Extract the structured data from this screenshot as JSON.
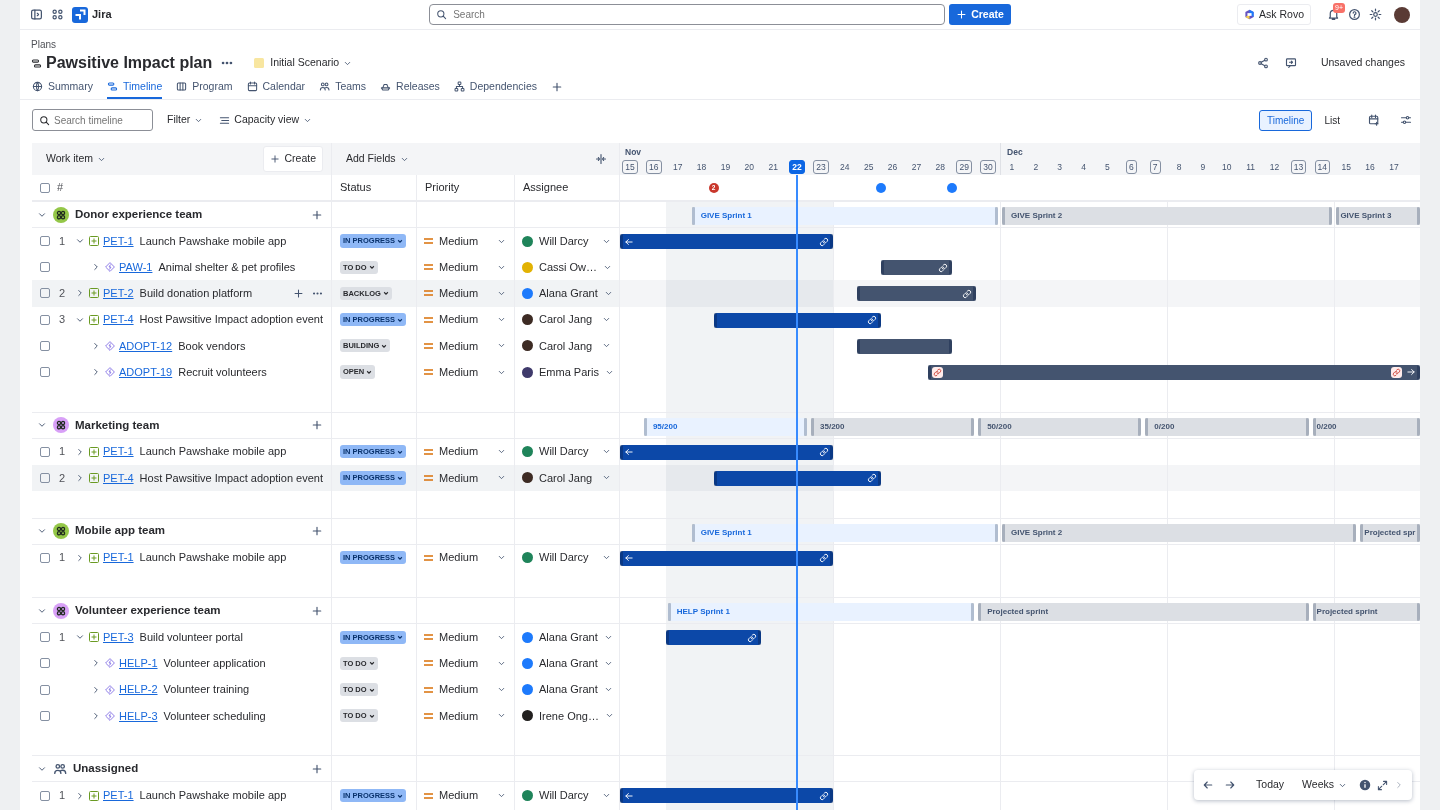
{
  "topbar": {
    "product": "Jira",
    "search": {
      "placeholder": "Search"
    },
    "create": "Create",
    "ask": "Ask Rovo",
    "notifications": "9+"
  },
  "breadcrumb": "Plans",
  "plan": {
    "title": "Pawsitive Impact plan",
    "scenario": "Initial Scenario",
    "unsaved": "Unsaved changes"
  },
  "tabs": [
    {
      "label": "Summary",
      "selected": false
    },
    {
      "label": "Timeline",
      "selected": true
    },
    {
      "label": "Program",
      "selected": false
    },
    {
      "label": "Calendar",
      "selected": false
    },
    {
      "label": "Teams",
      "selected": false
    },
    {
      "label": "Releases",
      "selected": false
    },
    {
      "label": "Dependencies",
      "selected": false
    }
  ],
  "toolbar": {
    "search": {
      "placeholder": "Search timeline"
    },
    "filter": "Filter",
    "capacity": "Capacity view",
    "views": [
      {
        "label": "Timeline",
        "selected": true
      },
      {
        "label": "List",
        "selected": false
      }
    ]
  },
  "table": {
    "work_item": "Work item",
    "create": "Create",
    "add_fields": "Add Fields",
    "select_all_checked": false,
    "columns": [
      "#",
      "Status",
      "Priority",
      "Assignee"
    ]
  },
  "timeline": {
    "days": [
      {
        "label": "15",
        "month": "Nov",
        "weekend": true,
        "today": false
      },
      {
        "label": "16",
        "weekend": true,
        "today": false
      },
      {
        "label": "17",
        "weekend": false,
        "today": false
      },
      {
        "label": "18",
        "weekend": false,
        "today": false
      },
      {
        "label": "19",
        "weekend": false,
        "today": false
      },
      {
        "label": "20",
        "weekend": false,
        "today": false
      },
      {
        "label": "21",
        "weekend": false,
        "today": false
      },
      {
        "label": "22",
        "weekend": true,
        "today": true
      },
      {
        "label": "23",
        "weekend": true,
        "today": false
      },
      {
        "label": "24",
        "weekend": false,
        "today": false
      },
      {
        "label": "25",
        "weekend": false,
        "today": false
      },
      {
        "label": "26",
        "weekend": false,
        "today": false
      },
      {
        "label": "27",
        "weekend": false,
        "today": false
      },
      {
        "label": "28",
        "weekend": false,
        "today": false
      },
      {
        "label": "29",
        "weekend": true,
        "today": false
      },
      {
        "label": "30",
        "weekend": true,
        "today": false
      },
      {
        "label": "1",
        "month": "Dec",
        "weekend": false,
        "today": false
      },
      {
        "label": "2",
        "weekend": false,
        "today": false
      },
      {
        "label": "3",
        "weekend": false,
        "today": false
      },
      {
        "label": "4",
        "weekend": false,
        "today": false
      },
      {
        "label": "5",
        "weekend": false,
        "today": false
      },
      {
        "label": "6",
        "weekend": true,
        "today": false
      },
      {
        "label": "7",
        "weekend": true,
        "today": false
      },
      {
        "label": "8",
        "weekend": false,
        "today": false
      },
      {
        "label": "9",
        "weekend": false,
        "today": false
      },
      {
        "label": "10",
        "weekend": false,
        "today": false
      },
      {
        "label": "11",
        "weekend": false,
        "today": false
      },
      {
        "label": "12",
        "weekend": false,
        "today": false
      },
      {
        "label": "13",
        "weekend": true,
        "today": false
      },
      {
        "label": "14",
        "weekend": true,
        "today": false
      },
      {
        "label": "15",
        "weekend": false,
        "today": false
      },
      {
        "label": "16",
        "weekend": false,
        "today": false
      },
      {
        "label": "17",
        "weekend": false,
        "today": false
      }
    ],
    "markers": [
      {
        "position": {
          "level": 0.1169
        },
        "kind": "warning",
        "label": "2"
      },
      {
        "position": {
          "level": 0.3258
        },
        "kind": "milestone"
      },
      {
        "position": {
          "level": 0.4154
        },
        "kind": "milestone"
      }
    ]
  },
  "teams": [
    {
      "name": "Donor experience team",
      "color": "#94c748",
      "expanded": true,
      "sprints": [
        {
          "label": "GIVE Sprint 1",
          "start": {
            "level": 0.0871
          },
          "end": {
            "level": 0.4751
          },
          "kind": "active"
        },
        {
          "label": "GIVE Sprint 2",
          "start": {
            "level": 0.4751
          },
          "end": {
            "level": 0.893
          },
          "kind": "future"
        },
        {
          "label": "GIVE Sprint 3",
          "start": {
            "level": 0.893
          },
          "end": {
            "level": 1
          },
          "kind": "future"
        }
      ],
      "rows": [
        {
          "rank": "1",
          "checked": false,
          "kind": "epic",
          "key": "PET-1",
          "summary": "Launch Pawshake mobile app",
          "expanded": true,
          "highlighted": false,
          "status": {
            "label": "IN PROGRESS",
            "kind": "progress"
          },
          "priority": "Medium",
          "assignee": {
            "name": "Will Darcy",
            "color": "#1f845a"
          },
          "bar": {
            "start": {
              "level": 0
            },
            "end": {
              "level": 0.2661
            },
            "end_link": {
              "kind": "ok"
            }
          },
          "children": [
            {
              "checked": false,
              "kind": "child",
              "key": "PAW-1",
              "summary": "Animal shelter & pet profiles",
              "expanded": false,
              "highlighted": false,
              "status": {
                "label": "TO DO",
                "kind": "default"
              },
              "priority": "Medium",
              "assignee": {
                "name": "Cassi Ow…",
                "color": "#e2b203"
              },
              "bar": {
                "start": {
                  "level": 0.3258
                },
                "end": {
                  "level": 0.4154
                },
                "end_link": {
                  "kind": "ok"
                }
              }
            }
          ]
        },
        {
          "rank": "2",
          "checked": false,
          "kind": "epic",
          "key": "PET-2",
          "summary": "Build donation platform",
          "expanded": false,
          "highlighted": true,
          "actions": true,
          "status": {
            "label": "BACKLOG",
            "kind": "default"
          },
          "priority": "Medium",
          "assignee": {
            "name": "Alana Grant",
            "color": "#1d7afc"
          },
          "bar": {
            "start": {
              "level": 0.296
            },
            "end": {
              "level": 0.4452
            },
            "end_link": {
              "kind": "ok"
            }
          }
        },
        {
          "rank": "3",
          "checked": false,
          "kind": "epic",
          "key": "PET-4",
          "summary": "Host Pawsitive Impact adoption event",
          "expanded": true,
          "highlighted": false,
          "status": {
            "label": "IN PROGRESS",
            "kind": "progress"
          },
          "priority": "Medium",
          "assignee": {
            "name": "Carol Jang",
            "color": "#3d2b24"
          },
          "bar": {
            "start": {
              "level": 0.1169
            },
            "end": {
              "level": 0.3258
            },
            "end_link": {
              "kind": "ok"
            }
          },
          "children": [
            {
              "checked": false,
              "kind": "child",
              "key": "ADOPT-12",
              "summary": "Book vendors",
              "expanded": false,
              "highlighted": false,
              "status": {
                "label": "BUILDING",
                "kind": "default"
              },
              "priority": "Medium",
              "assignee": {
                "name": "Carol Jang",
                "color": "#3d2b24"
              },
              "bar": {
                "start": {
                  "level": 0.296
                },
                "end": {
                  "level": 0.4154
                }
              }
            },
            {
              "checked": false,
              "kind": "child",
              "key": "ADOPT-19",
              "summary": "Recruit volunteers",
              "expanded": false,
              "highlighted": false,
              "status": {
                "label": "OPEN",
                "kind": "default"
              },
              "priority": "Medium",
              "assignee": {
                "name": "Emma Paris",
                "color": "#3f3a6b"
              },
              "bar": {
                "start": {
                  "level": 0.3855
                },
                "end": {
                  "level": 1
                },
                "start_link": {
                  "kind": "warning"
                },
                "end_link": {
                  "kind": "warning"
                }
              }
            }
          ]
        }
      ]
    },
    {
      "name": "Marketing team",
      "color": "#d8a0f7",
      "expanded": true,
      "sprints": [
        {
          "label": "95/200",
          "start": {
            "level": 0.0274
          },
          "end": {
            "level": 0.2363
          },
          "kind": "active"
        },
        {
          "label": "35/200",
          "start": {
            "level": 0.2363
          },
          "end": {
            "level": 0.4452
          },
          "kind": "future"
        },
        {
          "label": "50/200",
          "start": {
            "level": 0.4452
          },
          "end": {
            "level": 0.6542
          },
          "kind": "future"
        },
        {
          "label": "0/200",
          "start": {
            "level": 0.6542
          },
          "end": {
            "level": 0.8632
          },
          "kind": "future"
        },
        {
          "label": "0/200",
          "start": {
            "level": 0.8632
          },
          "end": {
            "level": 1
          },
          "kind": "future"
        }
      ],
      "rows": [
        {
          "rank": "1",
          "checked": false,
          "kind": "epic",
          "key": "PET-1",
          "summary": "Launch Pawshake mobile app",
          "expanded": false,
          "highlighted": false,
          "status": {
            "label": "IN PROGRESS",
            "kind": "progress"
          },
          "priority": "Medium",
          "assignee": {
            "name": "Will Darcy",
            "color": "#1f845a"
          },
          "bar": {
            "start": {
              "level": 0
            },
            "end": {
              "level": 0.2661
            },
            "end_link": {
              "kind": "ok"
            }
          }
        },
        {
          "rank": "2",
          "checked": false,
          "kind": "epic",
          "key": "PET-4",
          "summary": "Host Pawsitive Impact adoption event",
          "expanded": false,
          "highlighted": true,
          "status": {
            "label": "IN PROGRESS",
            "kind": "progress"
          },
          "priority": "Medium",
          "assignee": {
            "name": "Carol Jang",
            "color": "#3d2b24"
          },
          "bar": {
            "start": {
              "level": 0.1169
            },
            "end": {
              "level": 0.3258
            },
            "end_link": {
              "kind": "ok"
            }
          }
        }
      ]
    },
    {
      "name": "Mobile app team",
      "color": "#94c748",
      "expanded": true,
      "sprints": [
        {
          "label": "GIVE Sprint 1",
          "start": {
            "level": 0.0871
          },
          "end": {
            "level": 0.4751
          },
          "kind": "active"
        },
        {
          "label": "GIVE Sprint 2",
          "start": {
            "level": 0.4751
          },
          "end": {
            "level": 0.9229
          },
          "kind": "future"
        },
        {
          "label": "Projected spr",
          "start": {
            "level": 0.9229
          },
          "end": {
            "level": 1
          },
          "kind": "future"
        }
      ],
      "rows": [
        {
          "rank": "1",
          "checked": false,
          "kind": "epic",
          "key": "PET-1",
          "summary": "Launch Pawshake mobile app",
          "expanded": false,
          "highlighted": false,
          "status": {
            "label": "IN PROGRESS",
            "kind": "progress"
          },
          "priority": "Medium",
          "assignee": {
            "name": "Will Darcy",
            "color": "#1f845a"
          },
          "bar": {
            "start": {
              "level": 0
            },
            "end": {
              "level": 0.2661
            },
            "end_link": {
              "kind": "ok"
            }
          }
        }
      ]
    },
    {
      "name": "Volunteer experience team",
      "color": "#d8a0f7",
      "expanded": true,
      "sprints": [
        {
          "label": "HELP Sprint 1",
          "start": {
            "level": 0.0572
          },
          "end": {
            "level": 0.4452
          },
          "kind": "active"
        },
        {
          "label": "Projected sprint",
          "start": {
            "level": 0.4452
          },
          "end": {
            "level": 0.8632
          },
          "kind": "future"
        },
        {
          "label": "Projected sprint",
          "start": {
            "level": 0.8632
          },
          "end": {
            "level": 1
          },
          "kind": "future"
        }
      ],
      "rows": [
        {
          "rank": "1",
          "checked": false,
          "kind": "epic",
          "key": "PET-3",
          "summary": "Build volunteer portal",
          "expanded": true,
          "highlighted": false,
          "status": {
            "label": "IN PROGRESS",
            "kind": "progress"
          },
          "priority": "Medium",
          "assignee": {
            "name": "Alana Grant",
            "color": "#1d7afc"
          },
          "bar": {
            "start": {
              "level": 0.0572
            },
            "end": {
              "level": 0.1766
            },
            "end_link": {
              "kind": "ok"
            }
          },
          "children": [
            {
              "checked": false,
              "kind": "child",
              "key": "HELP-1",
              "summary": "Volunteer application",
              "expanded": false,
              "highlighted": false,
              "status": {
                "label": "TO DO",
                "kind": "default"
              },
              "priority": "Medium",
              "assignee": {
                "name": "Alana Grant",
                "color": "#1d7afc"
              }
            },
            {
              "checked": false,
              "kind": "child",
              "key": "HELP-2",
              "summary": "Volunteer training",
              "expanded": false,
              "highlighted": false,
              "status": {
                "label": "TO DO",
                "kind": "default"
              },
              "priority": "Medium",
              "assignee": {
                "name": "Alana Grant",
                "color": "#1d7afc"
              }
            },
            {
              "checked": false,
              "kind": "child",
              "key": "HELP-3",
              "summary": "Volunteer scheduling",
              "expanded": false,
              "highlighted": false,
              "status": {
                "label": "TO DO",
                "kind": "default"
              },
              "priority": "Medium",
              "assignee": {
                "name": "Irene Ong…",
                "color": "#22201f"
              }
            }
          ]
        }
      ]
    },
    {
      "name": "Unassigned",
      "expanded": true,
      "rows": [
        {
          "rank": "1",
          "checked": false,
          "kind": "epic",
          "key": "PET-1",
          "summary": "Launch Pawshake mobile app",
          "expanded": false,
          "highlighted": false,
          "status": {
            "label": "IN PROGRESS",
            "kind": "progress"
          },
          "priority": "Medium",
          "assignee": {
            "name": "Will Darcy",
            "color": "#1f845a"
          },
          "bar": {
            "start": {
              "level": 0
            },
            "end": {
              "level": 0.2661
            },
            "end_link": {
              "kind": "ok"
            }
          }
        }
      ]
    }
  ],
  "navigator": {
    "today": "Today",
    "scale": "Weeks"
  }
}
